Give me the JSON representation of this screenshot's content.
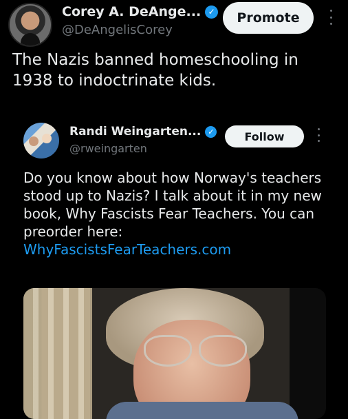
{
  "main_tweet": {
    "author_name": "Corey A. DeAnge...",
    "verified_mark": "✓",
    "handle": "@DeAngelisCorey",
    "promote_label": "Promote",
    "text": "The Nazis banned homeschooling in 1938 to indoctrinate kids."
  },
  "quoted_tweet": {
    "author_name": "Randi Weingarten...",
    "verified_mark": "✓",
    "handle": "@rweingarten",
    "follow_label": "Follow",
    "text": "Do you know about how Norway's teachers stood up to Nazis? I talk about it in my new book, Why Fascists Fear Teachers. You can preorder here: ",
    "link_text": "WhyFascistsFearTeachers.com"
  },
  "icons": {
    "verified": "verified-badge-icon",
    "more": "more-options-icon"
  },
  "colors": {
    "background": "#000000",
    "link": "#1d9bf0",
    "verified": "#1d9bf0",
    "secondary_text": "#71767b"
  }
}
